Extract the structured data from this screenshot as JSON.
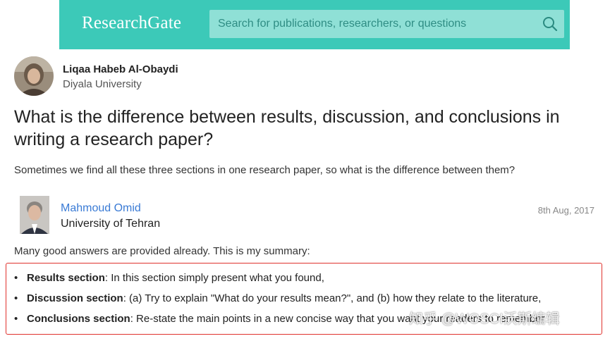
{
  "header": {
    "logo": "ResearchGate",
    "search_placeholder": "Search for publications, researchers, or questions",
    "search_icon": "search-icon",
    "brand_color": "#3cc9b8"
  },
  "question": {
    "author_name": "Liqaa Habeb Al-Obaydi",
    "author_institution": "Diyala University",
    "title": "What is the difference between results, discussion, and conclusions in writing a research paper?",
    "body": "Sometimes we find all these three sections in one research paper, so what is the difference between them?"
  },
  "answer": {
    "author_name": "Mahmoud Omid",
    "author_institution": "University of Tehran",
    "date": "8th Aug, 2017",
    "intro": "Many good answers are provided already. This is my summary:",
    "items": [
      {
        "term": "Results section",
        "text": ": In this section simply present what you found,"
      },
      {
        "term": "Discussion section",
        "text": ": (a) Try to explain \"What do your results mean?\", and (b) how they relate to the literature,"
      },
      {
        "term": "Conclusions section",
        "text": ": Re-state the main points in a new concise way that you want your readers to remember"
      }
    ],
    "highlight_color": "#e0322d"
  },
  "watermark": "知乎 @WOSCI沃斯编辑"
}
